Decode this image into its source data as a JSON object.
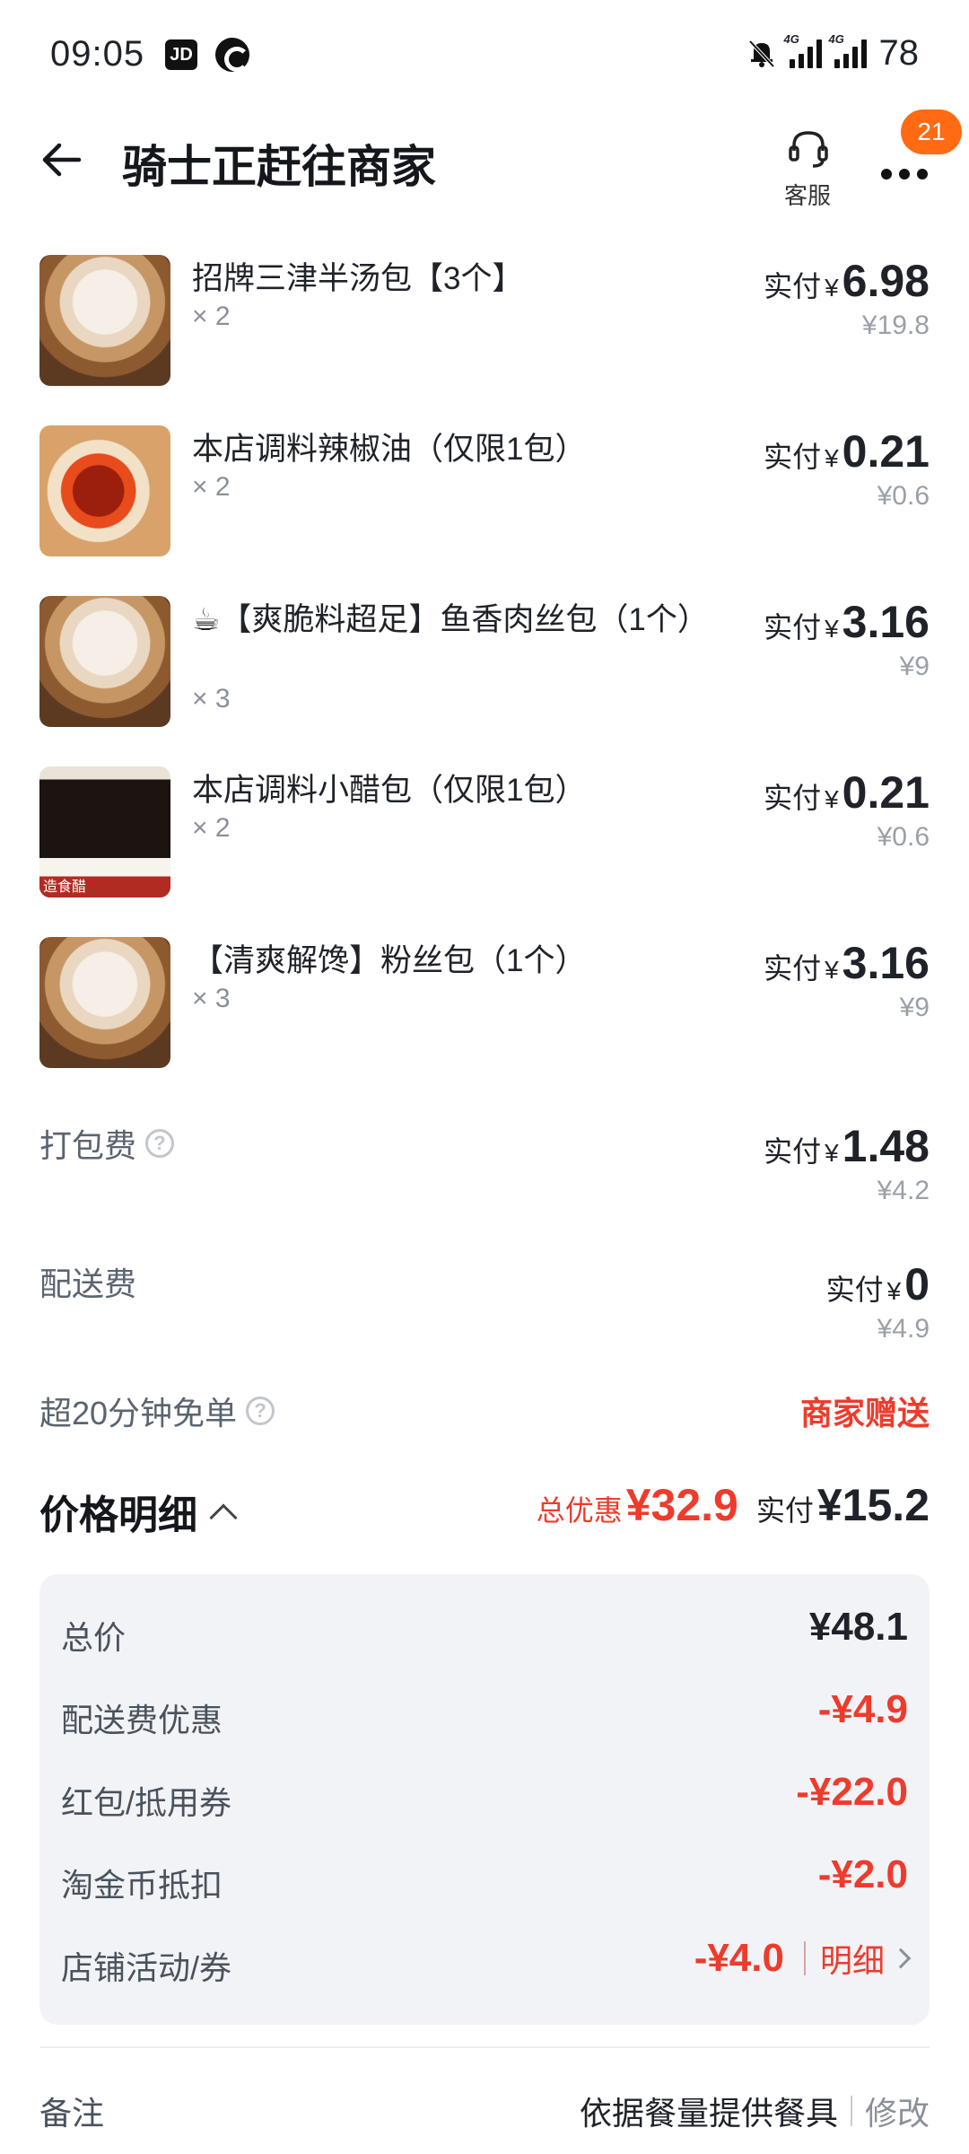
{
  "status_bar": {
    "time": "09:05",
    "app_badge": "JD",
    "network_left": "4G",
    "network_right": "4G",
    "battery": "78"
  },
  "header": {
    "title": "骑士正赶往商家",
    "cs_label": "客服",
    "badge_count": "21"
  },
  "items": [
    {
      "name": "招牌三津半汤包【3个】",
      "qty": "× 2",
      "paid_label": "实付",
      "currency": "¥",
      "paid": "6.98",
      "original": "¥19.8"
    },
    {
      "name": "本店调料辣椒油（仅限1包）",
      "qty": "× 2",
      "paid_label": "实付",
      "currency": "¥",
      "paid": "0.21",
      "original": "¥0.6"
    },
    {
      "name": "☕【爽脆料超足】鱼香肉丝包（1个）",
      "qty": "× 3",
      "paid_label": "实付",
      "currency": "¥",
      "paid": "3.16",
      "original": "¥9"
    },
    {
      "name": "本店调料小醋包（仅限1包）",
      "qty": "× 2",
      "paid_label": "实付",
      "currency": "¥",
      "paid": "0.21",
      "original": "¥0.6",
      "thumb_label": "造食醋"
    },
    {
      "name": "【清爽解馋】粉丝包（1个）",
      "qty": "× 3",
      "paid_label": "实付",
      "currency": "¥",
      "paid": "3.16",
      "original": "¥9"
    }
  ],
  "fees": {
    "packing": {
      "label": "打包费",
      "paid_label": "实付",
      "currency": "¥",
      "paid": "1.48",
      "original": "¥4.2"
    },
    "delivery": {
      "label": "配送费",
      "paid_label": "实付",
      "currency": "¥",
      "paid": "0",
      "original": "¥4.9"
    },
    "free_overtime": {
      "label": "超20分钟免单",
      "value": "商家赠送"
    }
  },
  "price_detail": {
    "title": "价格明细",
    "discount_label": "总优惠",
    "discount_amount": "¥32.9",
    "paid_label": "实付",
    "paid_amount": "¥15.2",
    "rows": [
      {
        "label": "总价",
        "value": "¥48.1"
      },
      {
        "label": "配送费优惠",
        "value": "-¥4.9"
      },
      {
        "label": "红包/抵用券",
        "value": "-¥22.0"
      },
      {
        "label": "淘金币抵扣",
        "value": "-¥2.0"
      },
      {
        "label": "店铺活动/券",
        "value": "-¥4.0",
        "link": "明细"
      }
    ]
  },
  "remark": {
    "label": "备注",
    "value": "依据餐量提供餐具",
    "edit": "修改"
  },
  "colors": {
    "accent_red": "#ee3b2c",
    "badge_orange": "#ff6a13",
    "panel_bg": "#f1f3f7"
  }
}
